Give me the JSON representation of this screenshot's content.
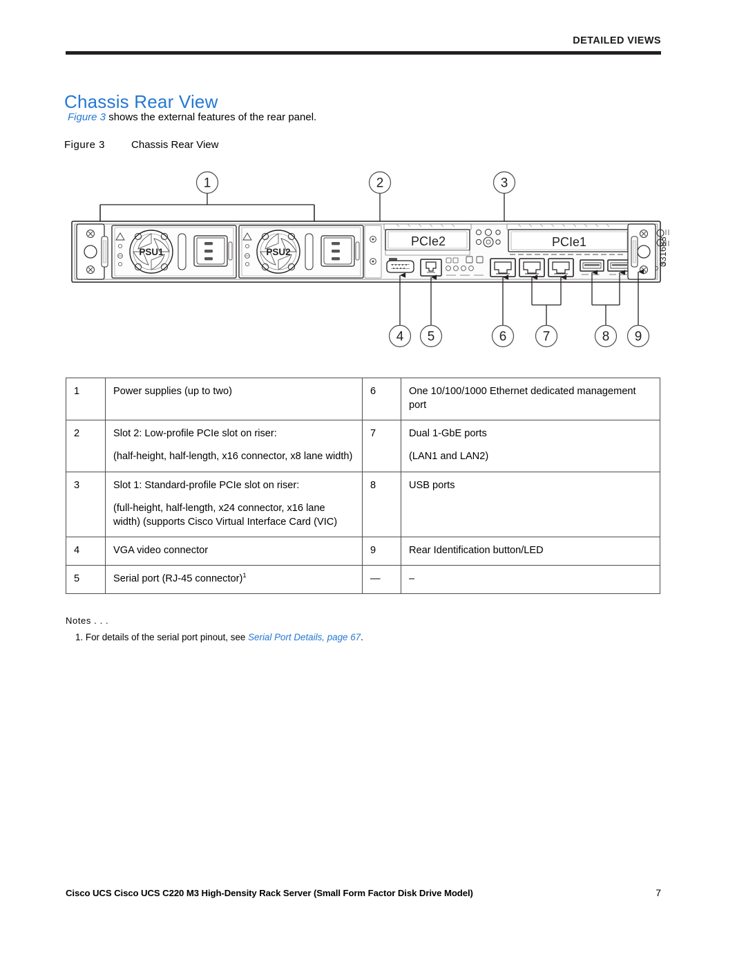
{
  "header": {
    "running_title": "DETAILED VIEWS"
  },
  "title": "Chassis Rear View",
  "intro": {
    "figure_ref": "Figure 3",
    "rest": " shows the external features of the rear panel."
  },
  "figure_caption": {
    "number": "Figure 3",
    "title": "Chassis Rear View"
  },
  "figure": {
    "labels": {
      "psu1": "PSU1",
      "psu2": "PSU2",
      "pcie2": "PCIe2",
      "pcie1": "PCIe1",
      "art_id": "331683"
    },
    "callouts_top": [
      "1",
      "2",
      "3"
    ],
    "callouts_bottom": [
      "4",
      "5",
      "6",
      "7",
      "8",
      "9"
    ]
  },
  "legend": {
    "rows": [
      {
        "left_num": "1",
        "left_p1": "Power supplies (up to two)",
        "left_p2": "",
        "right_num": "6",
        "right_p1": "One 10/100/1000 Ethernet dedicated management port",
        "right_p2": ""
      },
      {
        "left_num": "2",
        "left_p1": "Slot 2: Low-profile PCIe slot on riser:",
        "left_p2": "(half-height, half-length, x16 connector, x8 lane width)",
        "right_num": "7",
        "right_p1": "Dual 1-GbE ports",
        "right_p2": "(LAN1 and LAN2)"
      },
      {
        "left_num": "3",
        "left_p1": "Slot 1: Standard-profile PCIe slot on riser:",
        "left_p2": "(full-height, half-length, x24 connector, x16 lane width) (supports Cisco Virtual Interface Card (VIC)",
        "right_num": "8",
        "right_p1": "USB ports",
        "right_p2": ""
      },
      {
        "left_num": "4",
        "left_p1": "VGA video connector",
        "left_p2": "",
        "right_num": "9",
        "right_p1": "Rear Identification button/LED",
        "right_p2": ""
      },
      {
        "left_num": "5",
        "left_p1": "Serial port (RJ-45 connector)",
        "left_p1_sup": "1",
        "left_p2": "",
        "right_num": "—",
        "right_p1": "–",
        "right_p2": ""
      }
    ]
  },
  "notes": {
    "label": "Notes . . .",
    "item_prefix": "1. For details of the serial port pinout, see ",
    "item_link": "Serial Port Details, page 67",
    "item_suffix": "."
  },
  "footer": {
    "text": "Cisco UCS Cisco UCS C220 M3 High-Density Rack Server (Small Form Factor Disk Drive Model)",
    "page": "7"
  },
  "colors": {
    "link_blue": "#2477d4",
    "rule_black": "#231f20",
    "table_border": "#4c4c4c"
  }
}
